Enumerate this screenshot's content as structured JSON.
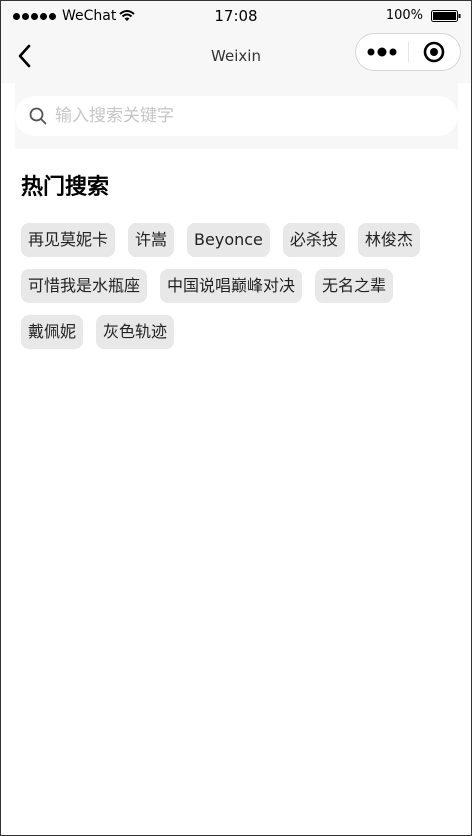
{
  "status_bar": {
    "carrier": "WeChat",
    "time": "17:08",
    "battery": "100%"
  },
  "nav": {
    "title": "Weixin"
  },
  "search": {
    "placeholder": "输入搜索关键字",
    "value": ""
  },
  "hot_search": {
    "title": "热门搜索",
    "tags": [
      "再见莫妮卡",
      "许嵩",
      "Beyonce",
      "必杀技",
      "林俊杰",
      "可惜我是水瓶座",
      "中国说唱巅峰对决",
      "无名之辈",
      "戴佩妮",
      "灰色轨迹"
    ]
  },
  "icons": [
    "signal-dots-icon",
    "wifi-icon",
    "battery-icon",
    "back-arrow-icon",
    "more-dots-icon",
    "close-target-icon",
    "search-icon"
  ]
}
